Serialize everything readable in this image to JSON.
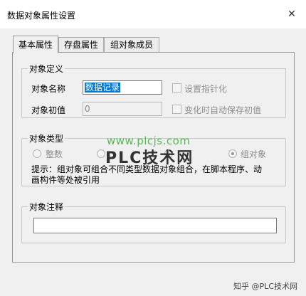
{
  "window": {
    "title": "数据对象属性设置"
  },
  "tabs": [
    {
      "label": "基本属性",
      "active": true
    },
    {
      "label": "存盘属性",
      "active": false
    },
    {
      "label": "组对象成员",
      "active": false
    }
  ],
  "object_definition": {
    "group_title": "对象定义",
    "name_label": "对象名称",
    "name_value": "数据记录",
    "initial_label": "对象初值",
    "initial_value": "0",
    "checkbox_pointer": "设置指针化",
    "checkbox_autosave": "变化时自动保存初值"
  },
  "object_type": {
    "group_title": "对象类型",
    "options": [
      {
        "label": "整数",
        "selected": false
      },
      {
        "label": "",
        "selected": false
      },
      {
        "label": "",
        "selected": false
      },
      {
        "label": "组对象",
        "selected": true
      }
    ],
    "hint_line1": "提示：组对象可组合不同类型数据对象组合，在脚本程序、动",
    "hint_line2": "画构件等处被引用"
  },
  "object_comment": {
    "group_title": "对象注释",
    "value": ""
  },
  "watermark": {
    "line1": "www.plcjs.com",
    "line2": "PLC技术网"
  },
  "credit": "知乎 @PLC技术网"
}
